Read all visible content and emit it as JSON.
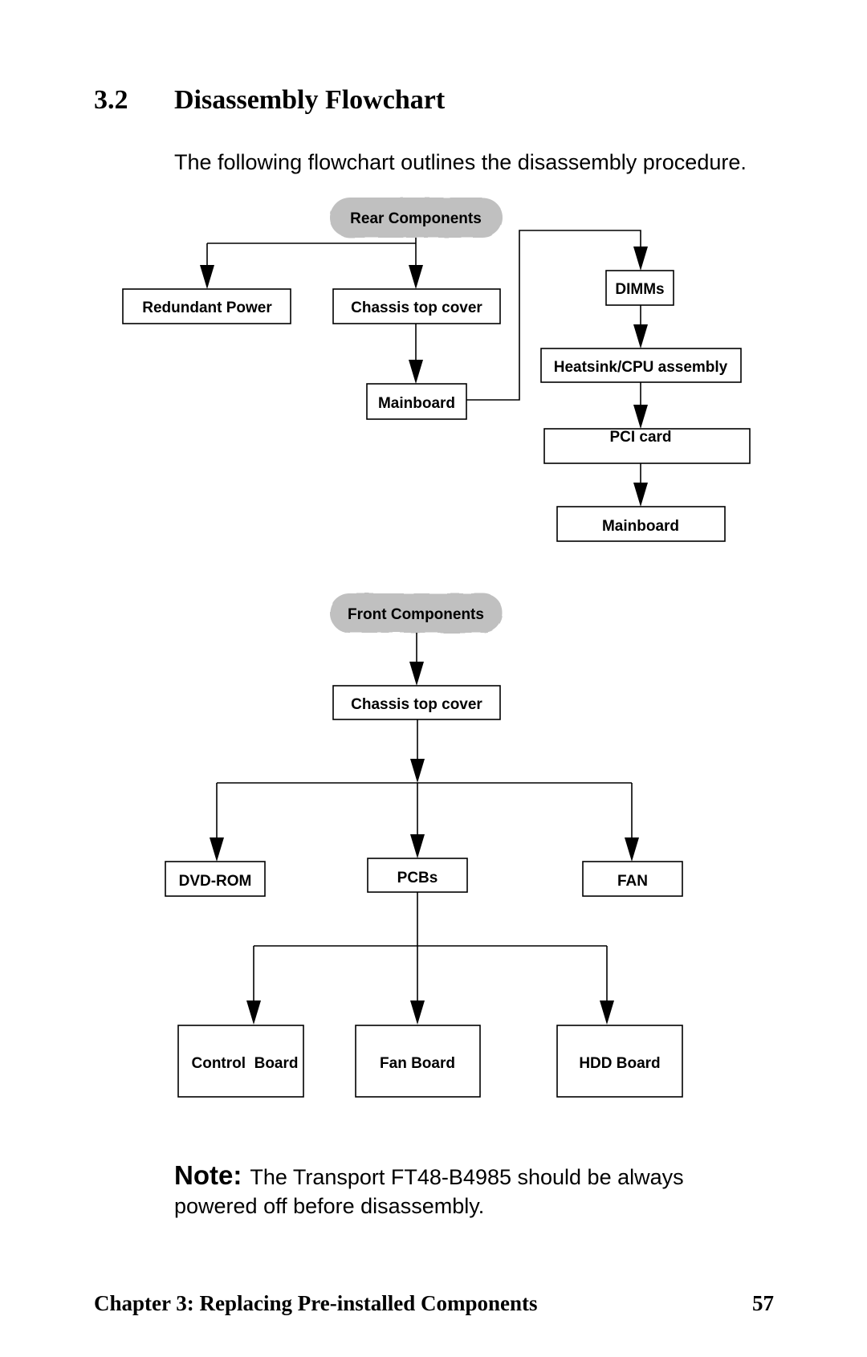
{
  "section": {
    "number": "3.2",
    "title": "Disassembly Flowchart",
    "intro": "The following flowchart outlines the disassembly procedure."
  },
  "flowchart": {
    "colors": {
      "pill_fill": "#c0c0c0",
      "line": "#000000",
      "box_fill": "#ffffff"
    },
    "rear": {
      "start": "Rear Components",
      "redundant_power": "Redundant Power",
      "chassis_top_cover": "Chassis top cover",
      "mainboard_left": "Mainboard",
      "dimms": "DIMMs",
      "heatsink_cpu": "Heatsink/CPU assembly",
      "pci_card": "PCI card",
      "mainboard_right": "Mainboard"
    },
    "front": {
      "start": "Front Components",
      "chassis_top_cover": "Chassis top cover",
      "dvd_rom": "DVD-ROM",
      "pcbs": "PCBs",
      "fan": "FAN",
      "control_board": "Control  Board",
      "fan_board": "Fan Board",
      "hdd_board": "HDD Board"
    }
  },
  "note": {
    "label": "Note:",
    "text": "The Transport FT48-B4985 should be always powered off before disassembly."
  },
  "footer": {
    "chapter": "Chapter 3: Replacing Pre-installed Components",
    "page": "57"
  }
}
